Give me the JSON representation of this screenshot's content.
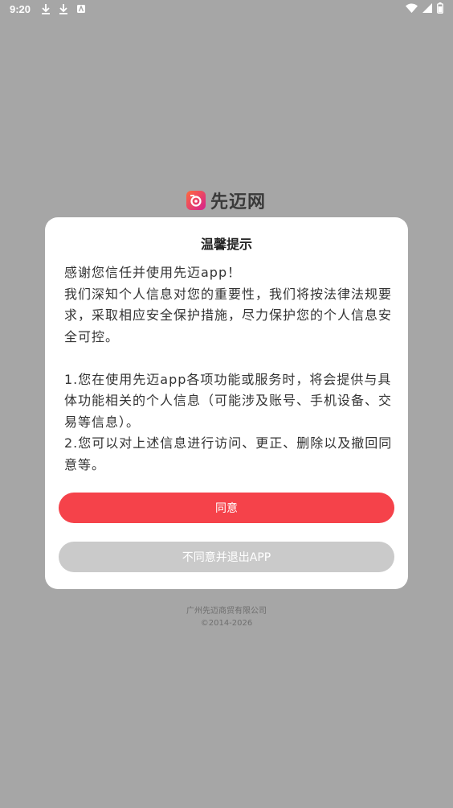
{
  "status_bar": {
    "time": "9:20",
    "left_icons": [
      "download-icon",
      "download-icon",
      "font-icon"
    ],
    "right_icons": [
      "wifi-icon",
      "signal-icon",
      "battery-icon"
    ]
  },
  "brand": {
    "name": "先迈网",
    "logo_colors": [
      "#ff6a3d",
      "#d4218f"
    ]
  },
  "dialog": {
    "title": "温馨提示",
    "paragraphs": [
      "感谢您信任并使用先迈app！",
      "我们深知个人信息对您的重要性，我们将按法律法规要求，采取相应安全保护措施，尽力保护您的个人信息安全可控。",
      "1.您在使用先迈app各项功能或服务时，将会提供与具体功能相关的个人信息（可能涉及账号、手机设备、交易等信息）。",
      "2.您可以对上述信息进行访问、更正、删除以及撤回同意等。"
    ],
    "agree_label": "同意",
    "disagree_label": "不同意并退出APP"
  },
  "footer": {
    "company": "广州先迈商贸有限公司",
    "copyright": "©2014-2026"
  },
  "colors": {
    "overlay": "#a6a6a6",
    "accent": "#f5424a",
    "disabled": "#cacaca"
  }
}
